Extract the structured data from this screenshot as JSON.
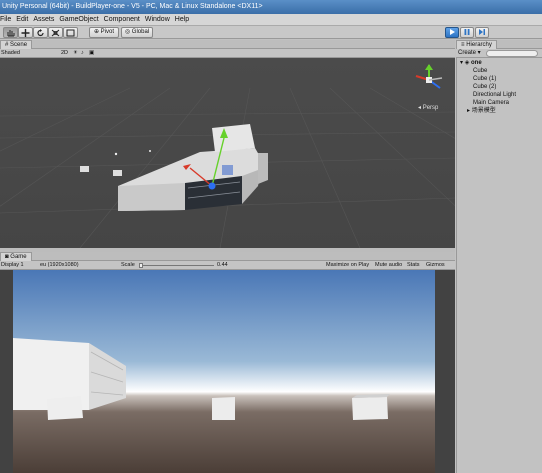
{
  "window": {
    "title": "Unity Personal (64bit) - BuildPlayer-one - V5 - PC, Mac & Linux Standalone <DX11>"
  },
  "menu": [
    "File",
    "Edit",
    "Assets",
    "GameObject",
    "Component",
    "Window",
    "Help"
  ],
  "toolbar": {
    "pivot_label": "Pivot",
    "global_label": "Global"
  },
  "scene": {
    "tab_label": "Scene",
    "shading_mode": "Shaded",
    "mode_2d": "2D",
    "persp_label": "Persp"
  },
  "hierarchy": {
    "tab_label": "Hierarchy",
    "create_label": "Create",
    "scene_name": "one",
    "items": [
      "Cube",
      "Cube (1)",
      "Cube (2)",
      "Directional Light",
      "Main Camera",
      "场景模型"
    ]
  },
  "game": {
    "tab_label": "Game",
    "display": "Display 1",
    "resolution": "eu (1920x1080)",
    "scale_label": "Scale",
    "scale_value": "0.44",
    "maximize_label": "Maximize on Play",
    "mute_label": "Mute audio",
    "stats_label": "Stats",
    "gizmos_label": "Gizmos"
  }
}
